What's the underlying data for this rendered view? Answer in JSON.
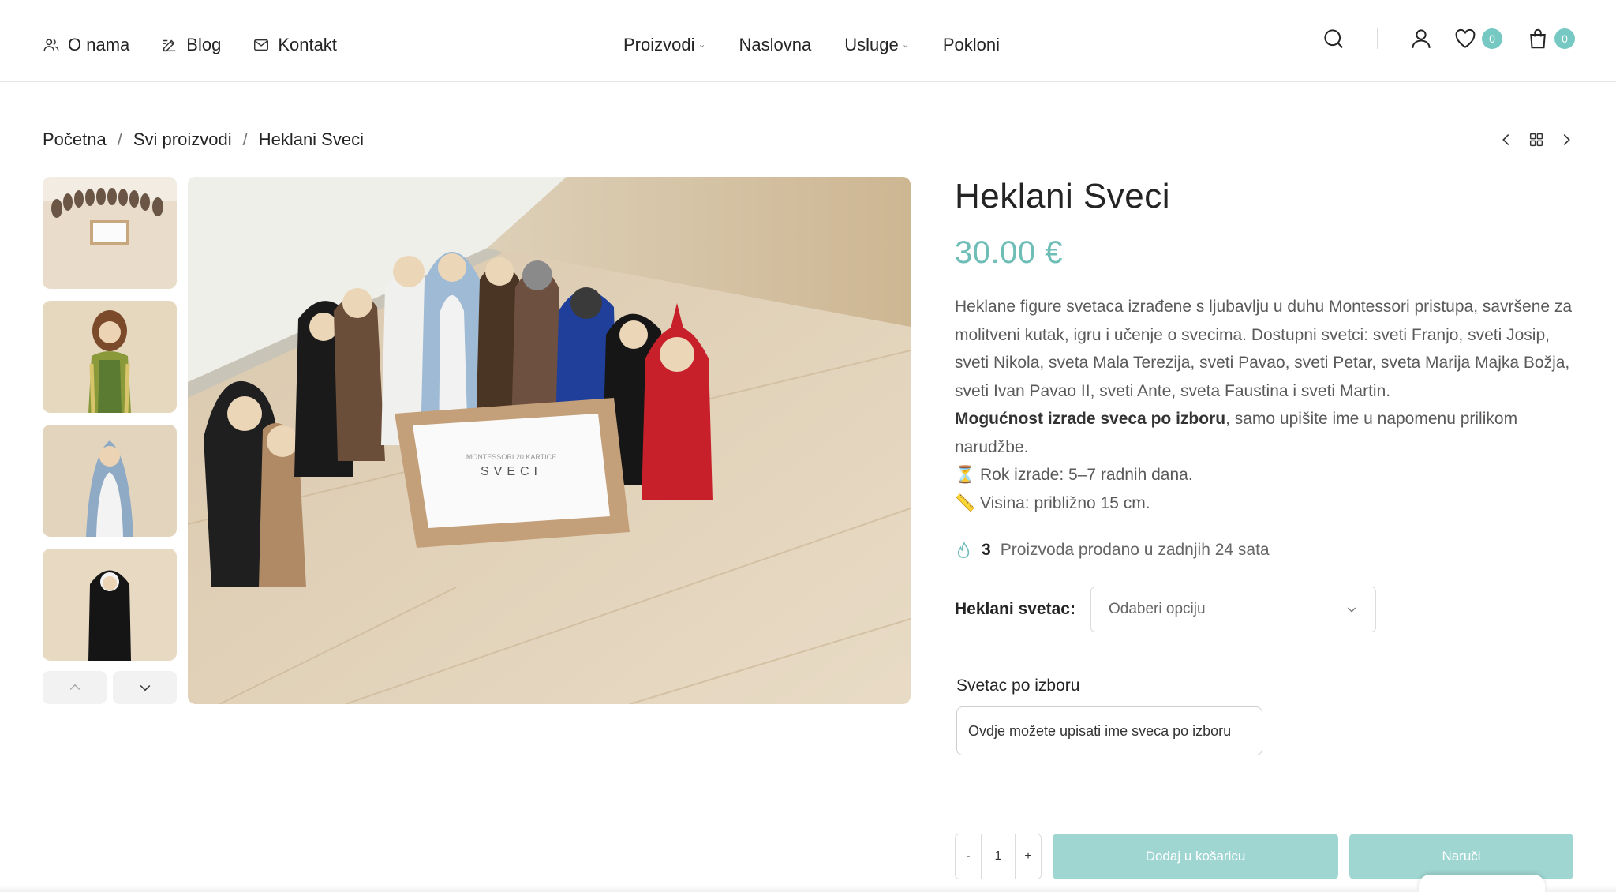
{
  "header": {
    "left_nav": [
      {
        "label": "O nama",
        "icon": "users-icon"
      },
      {
        "label": "Blog",
        "icon": "edit-icon"
      },
      {
        "label": "Kontakt",
        "icon": "mail-icon"
      }
    ],
    "center_nav": [
      {
        "label": "Proizvodi",
        "has_dropdown": true
      },
      {
        "label": "Naslovna",
        "has_dropdown": false
      },
      {
        "label": "Usluge",
        "has_dropdown": true
      },
      {
        "label": "Pokloni",
        "has_dropdown": false
      }
    ],
    "wishlist_count": "0",
    "cart_count": "0"
  },
  "breadcrumb": {
    "items": [
      "Početna",
      "Svi proizvodi",
      "Heklani Sveci"
    ],
    "separator": "/"
  },
  "gallery": {
    "thumbnails": [
      "thumb-group-photo",
      "thumb-saint-joseph",
      "thumb-virgin-mary",
      "thumb-nun-figure"
    ],
    "main_image": "crocheted-saints-group",
    "box_text_line1": "MONTESSORI 20 KARTICE",
    "box_text_line2": "SVECI"
  },
  "product": {
    "title": "Heklani Sveci",
    "price": "30.00 €",
    "description_line1": "Heklane figure svetaca izrađene s ljubavlju u duhu Montessori pristupa, savršene za molitveni kutak, igru i učenje o svecima. Dostupni svetci: sveti Franjo, sveti Josip, sveti Nikola, sveta Mala Terezija, sveti Pavao, sveti Petar, sveta Marija Majka Božja, sveti Ivan Pavao II, sveti Ante, sveta Faustina i sveti Martin.",
    "description_bold": "Mogućnost izrade sveca po izboru",
    "description_after_bold": ",  samo upišite ime u napomenu prilikom narudžbe.",
    "lead_time": "⏳ Rok izrade: 5–7 radnih dana.",
    "height": "📏 Visina: približno 15 cm.",
    "sold_count": "3",
    "sold_text": "Proizvoda prodano u zadnjih 24 sata",
    "variation_label": "Heklani svetac",
    "variation_colon": ":",
    "variation_selected": "Odaberi opciju",
    "custom_label": "Svetac po izboru",
    "custom_placeholder": "Ovdje možete upisati ime sveca po izboru",
    "quantity": "1",
    "qty_minus": "-",
    "qty_plus": "+",
    "add_to_cart": "Dodaj u košaricu",
    "order_now": "Naruči"
  },
  "colors": {
    "accent": "#6fbdb7",
    "button": "#9fd6d2",
    "badge": "#76c8c2"
  }
}
